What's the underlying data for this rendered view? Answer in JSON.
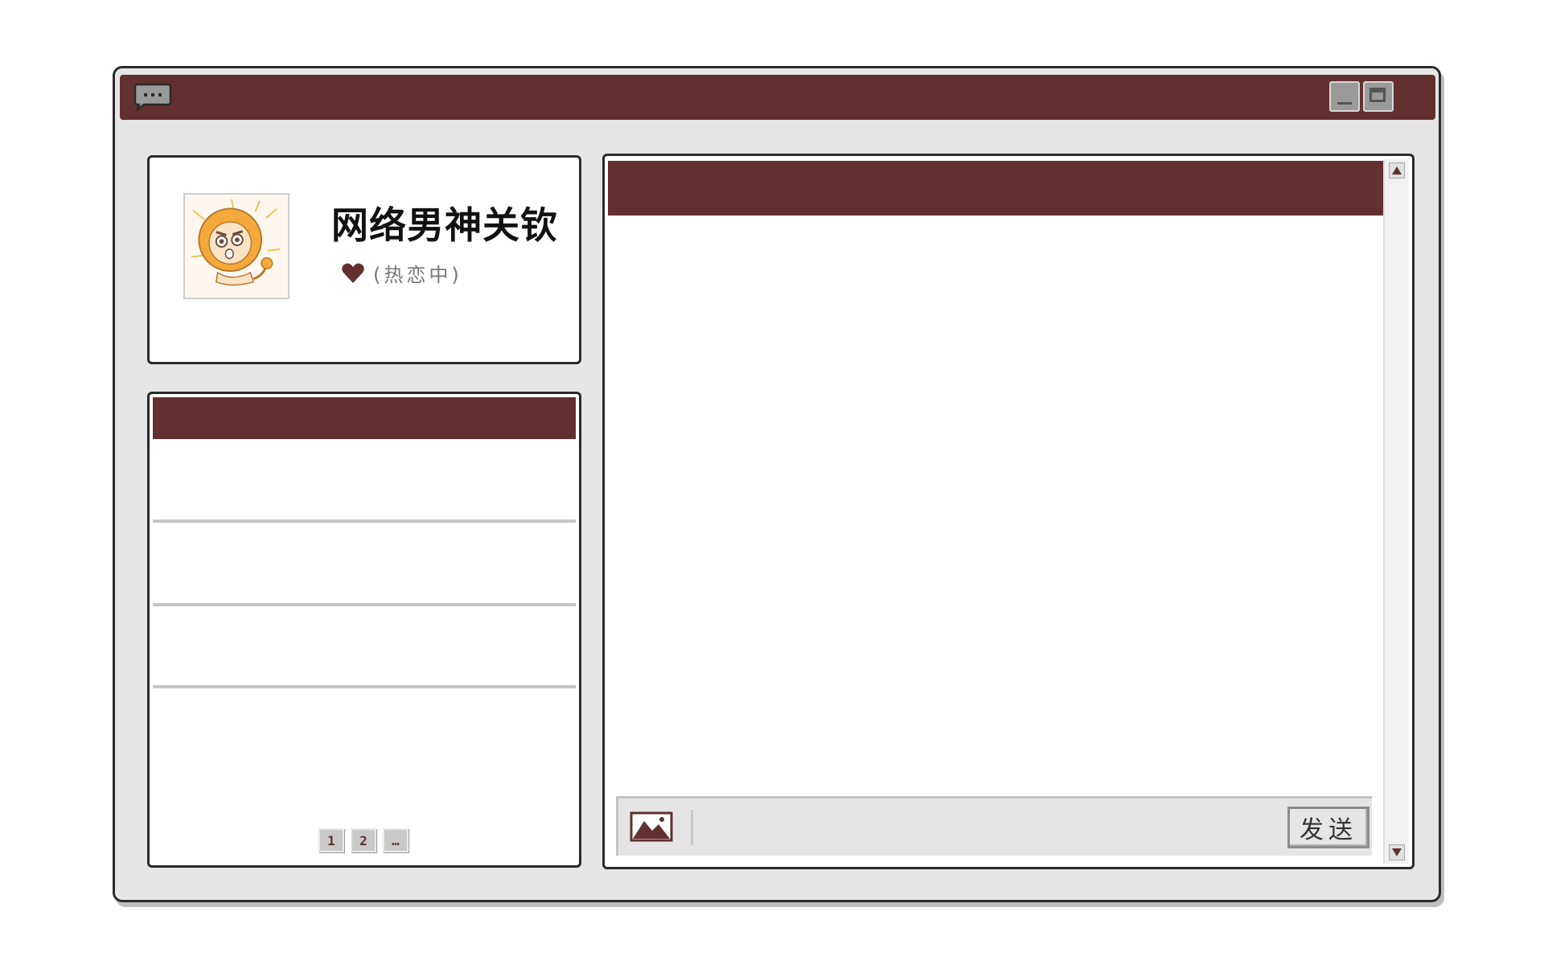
{
  "window": {
    "title": "",
    "icons": {
      "chat": "chat-bubble-icon",
      "minimize": "minimize-icon",
      "maximize": "maximize-icon"
    },
    "colors": {
      "accent": "#633030",
      "frame": "#e6e6e6",
      "panel": "#ffffff"
    }
  },
  "profile": {
    "name": "网络男神关钦",
    "status_icon": "heart-icon",
    "status": "(热恋中)",
    "avatar": "lion-cartoon-avatar"
  },
  "contacts": {
    "header": "",
    "items": [
      {
        "label": ""
      },
      {
        "label": ""
      },
      {
        "label": ""
      }
    ],
    "pages": [
      "1",
      "2",
      "…"
    ]
  },
  "chat": {
    "header": "",
    "input_placeholder": "",
    "image_icon": "image-icon",
    "send_label": "发送"
  }
}
